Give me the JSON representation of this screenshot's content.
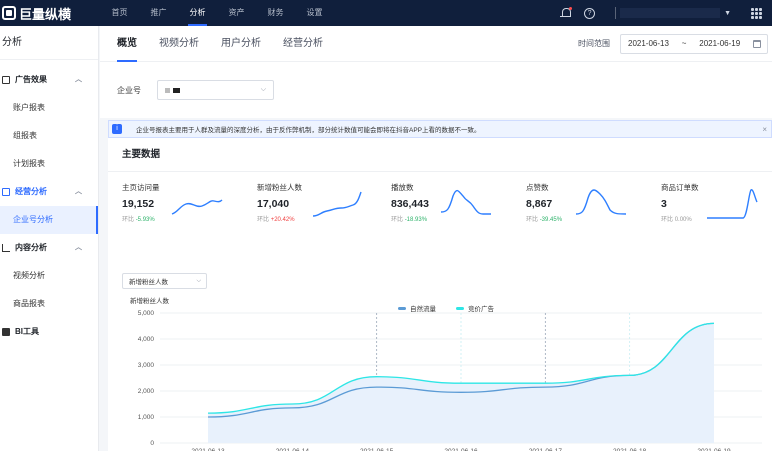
{
  "topbar": {
    "logo": "巨量纵横",
    "nav": [
      "首页",
      "推广",
      "分析",
      "资产",
      "财务",
      "设置"
    ],
    "active_nav": "分析"
  },
  "sidebar": {
    "title": "分析",
    "groups": [
      {
        "label": "广告效果",
        "items": [
          "账户报表",
          "组报表",
          "计划报表"
        ]
      },
      {
        "label": "经营分析",
        "items": [
          "企业号分析"
        ]
      },
      {
        "label": "内容分析",
        "items": [
          "视频分析",
          "商品报表"
        ]
      },
      {
        "label": "BI工具",
        "items": []
      }
    ]
  },
  "main": {
    "tabs": [
      "概览",
      "视频分析",
      "用户分析",
      "经营分析"
    ],
    "time_label": "时间范围",
    "date_start": "2021-06-13",
    "date_sep": "~",
    "date_end": "2021-06-19",
    "filter_label": "企业号",
    "notice": "企业号报表主要用于人群及流量的深度分析，由于反作弊机制，部分统计数值可能会即将在抖音APP上看的数据不一致。",
    "section_title": "主要数据",
    "metrics": [
      {
        "label": "主页访问量",
        "value": "19,152",
        "change_label": "环比",
        "change": "-5.93%",
        "trend": "down"
      },
      {
        "label": "新增粉丝人数",
        "value": "17,040",
        "change_label": "环比",
        "change": "+20.42%",
        "trend": "up"
      },
      {
        "label": "播放数",
        "value": "836,443",
        "change_label": "环比",
        "change": "-18.93%",
        "trend": "down"
      },
      {
        "label": "点赞数",
        "value": "8,867",
        "change_label": "环比",
        "change": "-39.45%",
        "trend": "down"
      },
      {
        "label": "商品订单数",
        "value": "3",
        "change_label": "环比",
        "change": "0.00%",
        "trend": "flat"
      }
    ],
    "metric_select": "新增粉丝人数",
    "chart_title": "新增粉丝人数"
  },
  "colors": {
    "accent": "#2e6bff",
    "natural": "#5b9bd5",
    "paid": "#2ee6e6",
    "up": "#f04040",
    "down": "#2fb36b"
  },
  "chart_data": {
    "type": "line",
    "title": "新增粉丝人数",
    "x": [
      "2021-06-13",
      "2021-06-14",
      "2021-06-15",
      "2021-06-16",
      "2021-06-17",
      "2021-06-18",
      "2021-06-19"
    ],
    "series": [
      {
        "name": "自然流量",
        "values": [
          1000,
          1350,
          2150,
          1950,
          2150,
          2600,
          4600
        ]
      },
      {
        "name": "竞价广告",
        "values": [
          1150,
          1500,
          2550,
          2300,
          2300,
          2600,
          4600
        ]
      }
    ],
    "ylim": [
      0,
      5000
    ],
    "yticks": [
      "0",
      "1,000",
      "2,000",
      "3,000",
      "4,000",
      "5,000"
    ],
    "grid": true,
    "legend": "top-center"
  }
}
